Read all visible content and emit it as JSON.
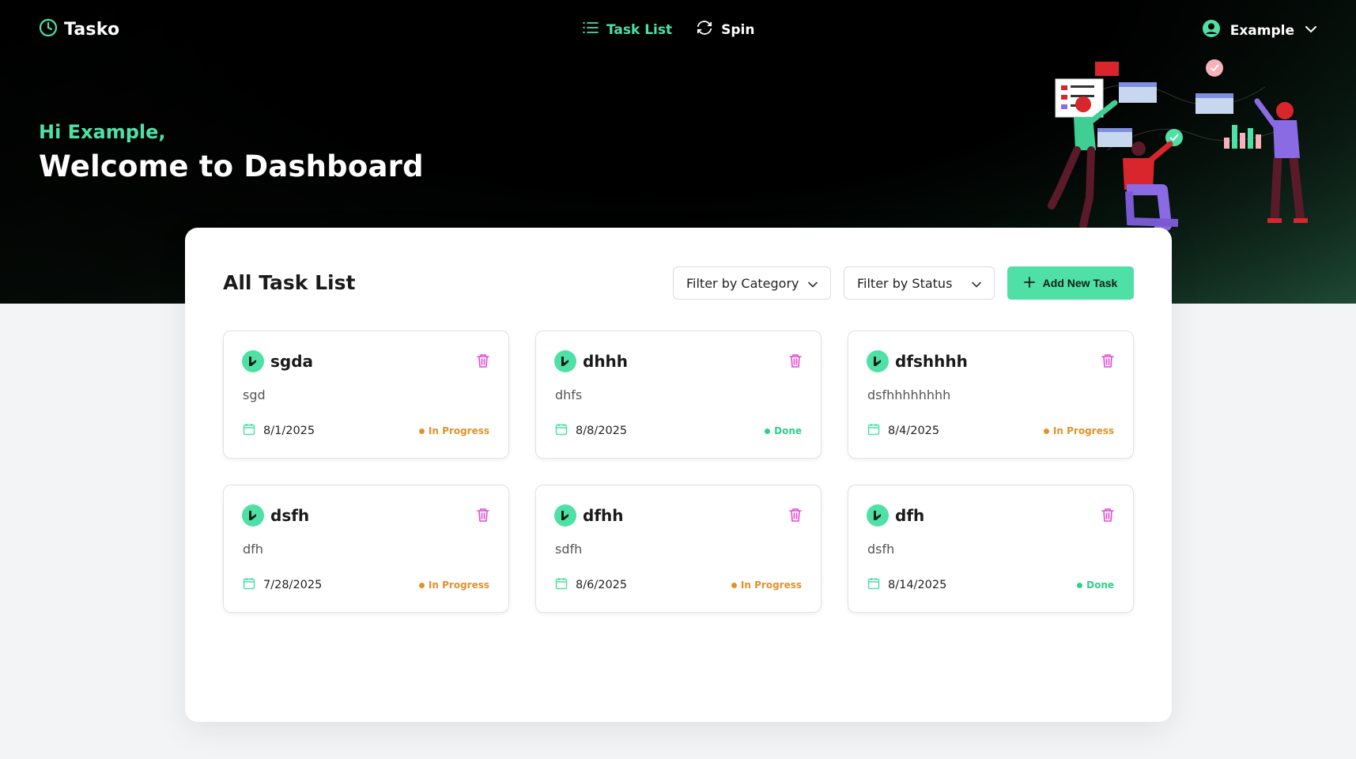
{
  "brand": {
    "name": "Tasko",
    "icon": "clock-icon"
  },
  "nav": {
    "links": [
      {
        "label": "Task List",
        "icon": "list-icon",
        "active": true
      },
      {
        "label": "Spin",
        "icon": "refresh-icon",
        "active": false
      }
    ]
  },
  "user": {
    "name": "Example",
    "icon": "user-circle-icon"
  },
  "hero": {
    "greeting": "Hi Example,",
    "title": "Welcome to Dashboard"
  },
  "panel": {
    "title": "All Task List",
    "filter_category": "Filter by Category",
    "filter_status": "Filter by Status",
    "add_button": "Add New Task"
  },
  "colors": {
    "accent": "#4fe0a6",
    "in_progress": "#e0922a",
    "done": "#2fcf8a",
    "trash": "#e14bd6"
  },
  "tasks": [
    {
      "title": "sgda",
      "description": "sgd",
      "date": "8/1/2025",
      "status": "In Progress"
    },
    {
      "title": "dhhh",
      "description": "dhfs",
      "date": "8/8/2025",
      "status": "Done"
    },
    {
      "title": "dfshhhh",
      "description": "dsfhhhhhhhh",
      "date": "8/4/2025",
      "status": "In Progress"
    },
    {
      "title": "dsfh",
      "description": "dfh",
      "date": "7/28/2025",
      "status": "In Progress"
    },
    {
      "title": "dfhh",
      "description": "sdfh",
      "date": "8/6/2025",
      "status": "In Progress"
    },
    {
      "title": "dfh",
      "description": "dsfh",
      "date": "8/14/2025",
      "status": "Done"
    }
  ]
}
